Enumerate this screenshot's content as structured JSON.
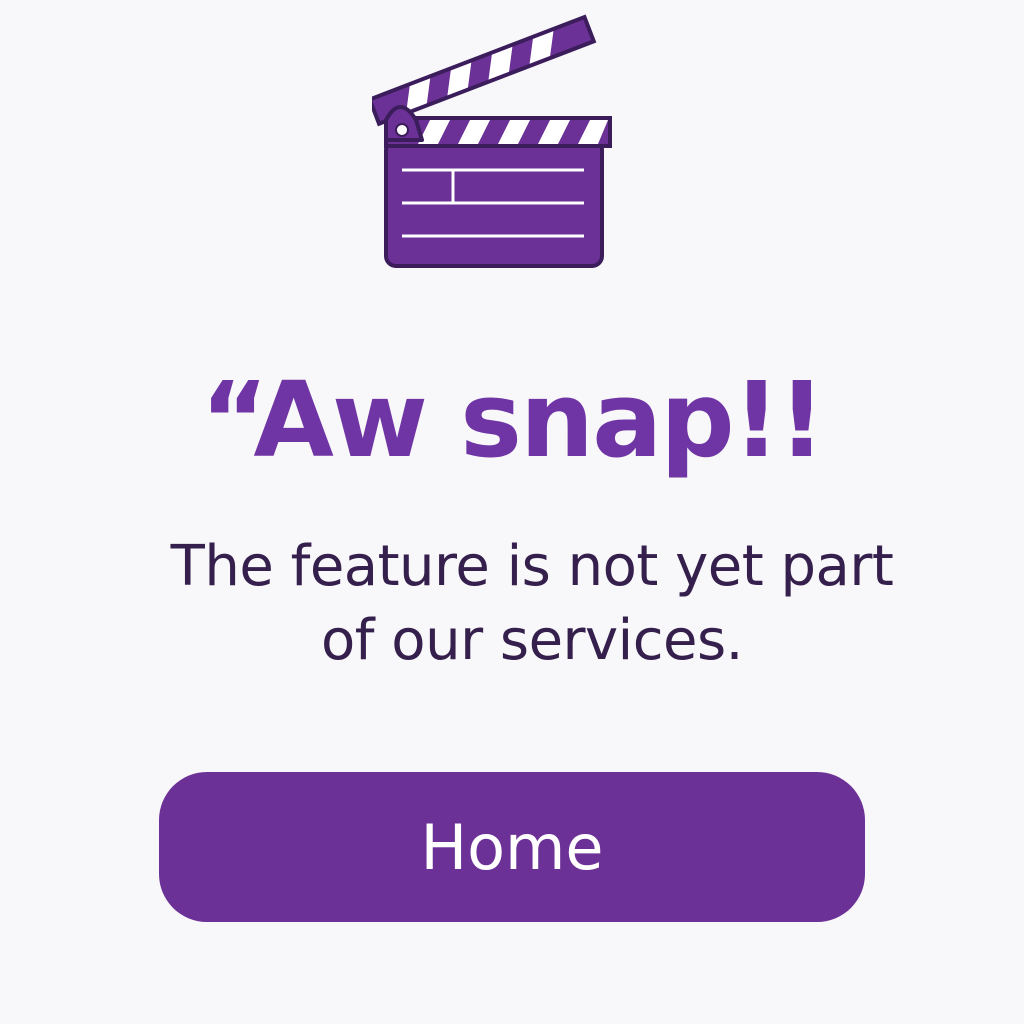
{
  "illustration": {
    "icon": "clapperboard-icon"
  },
  "error": {
    "headline": "“Aw snap!!",
    "message": "The feature is not yet part of our services."
  },
  "actions": {
    "home_label": "Home"
  },
  "colors": {
    "background": "#f8f7f9",
    "accent": "#6b3196",
    "headline": "#6f35a5",
    "body_text": "#35204d",
    "outline": "#3c1d5c",
    "button_text": "#ffffff"
  }
}
